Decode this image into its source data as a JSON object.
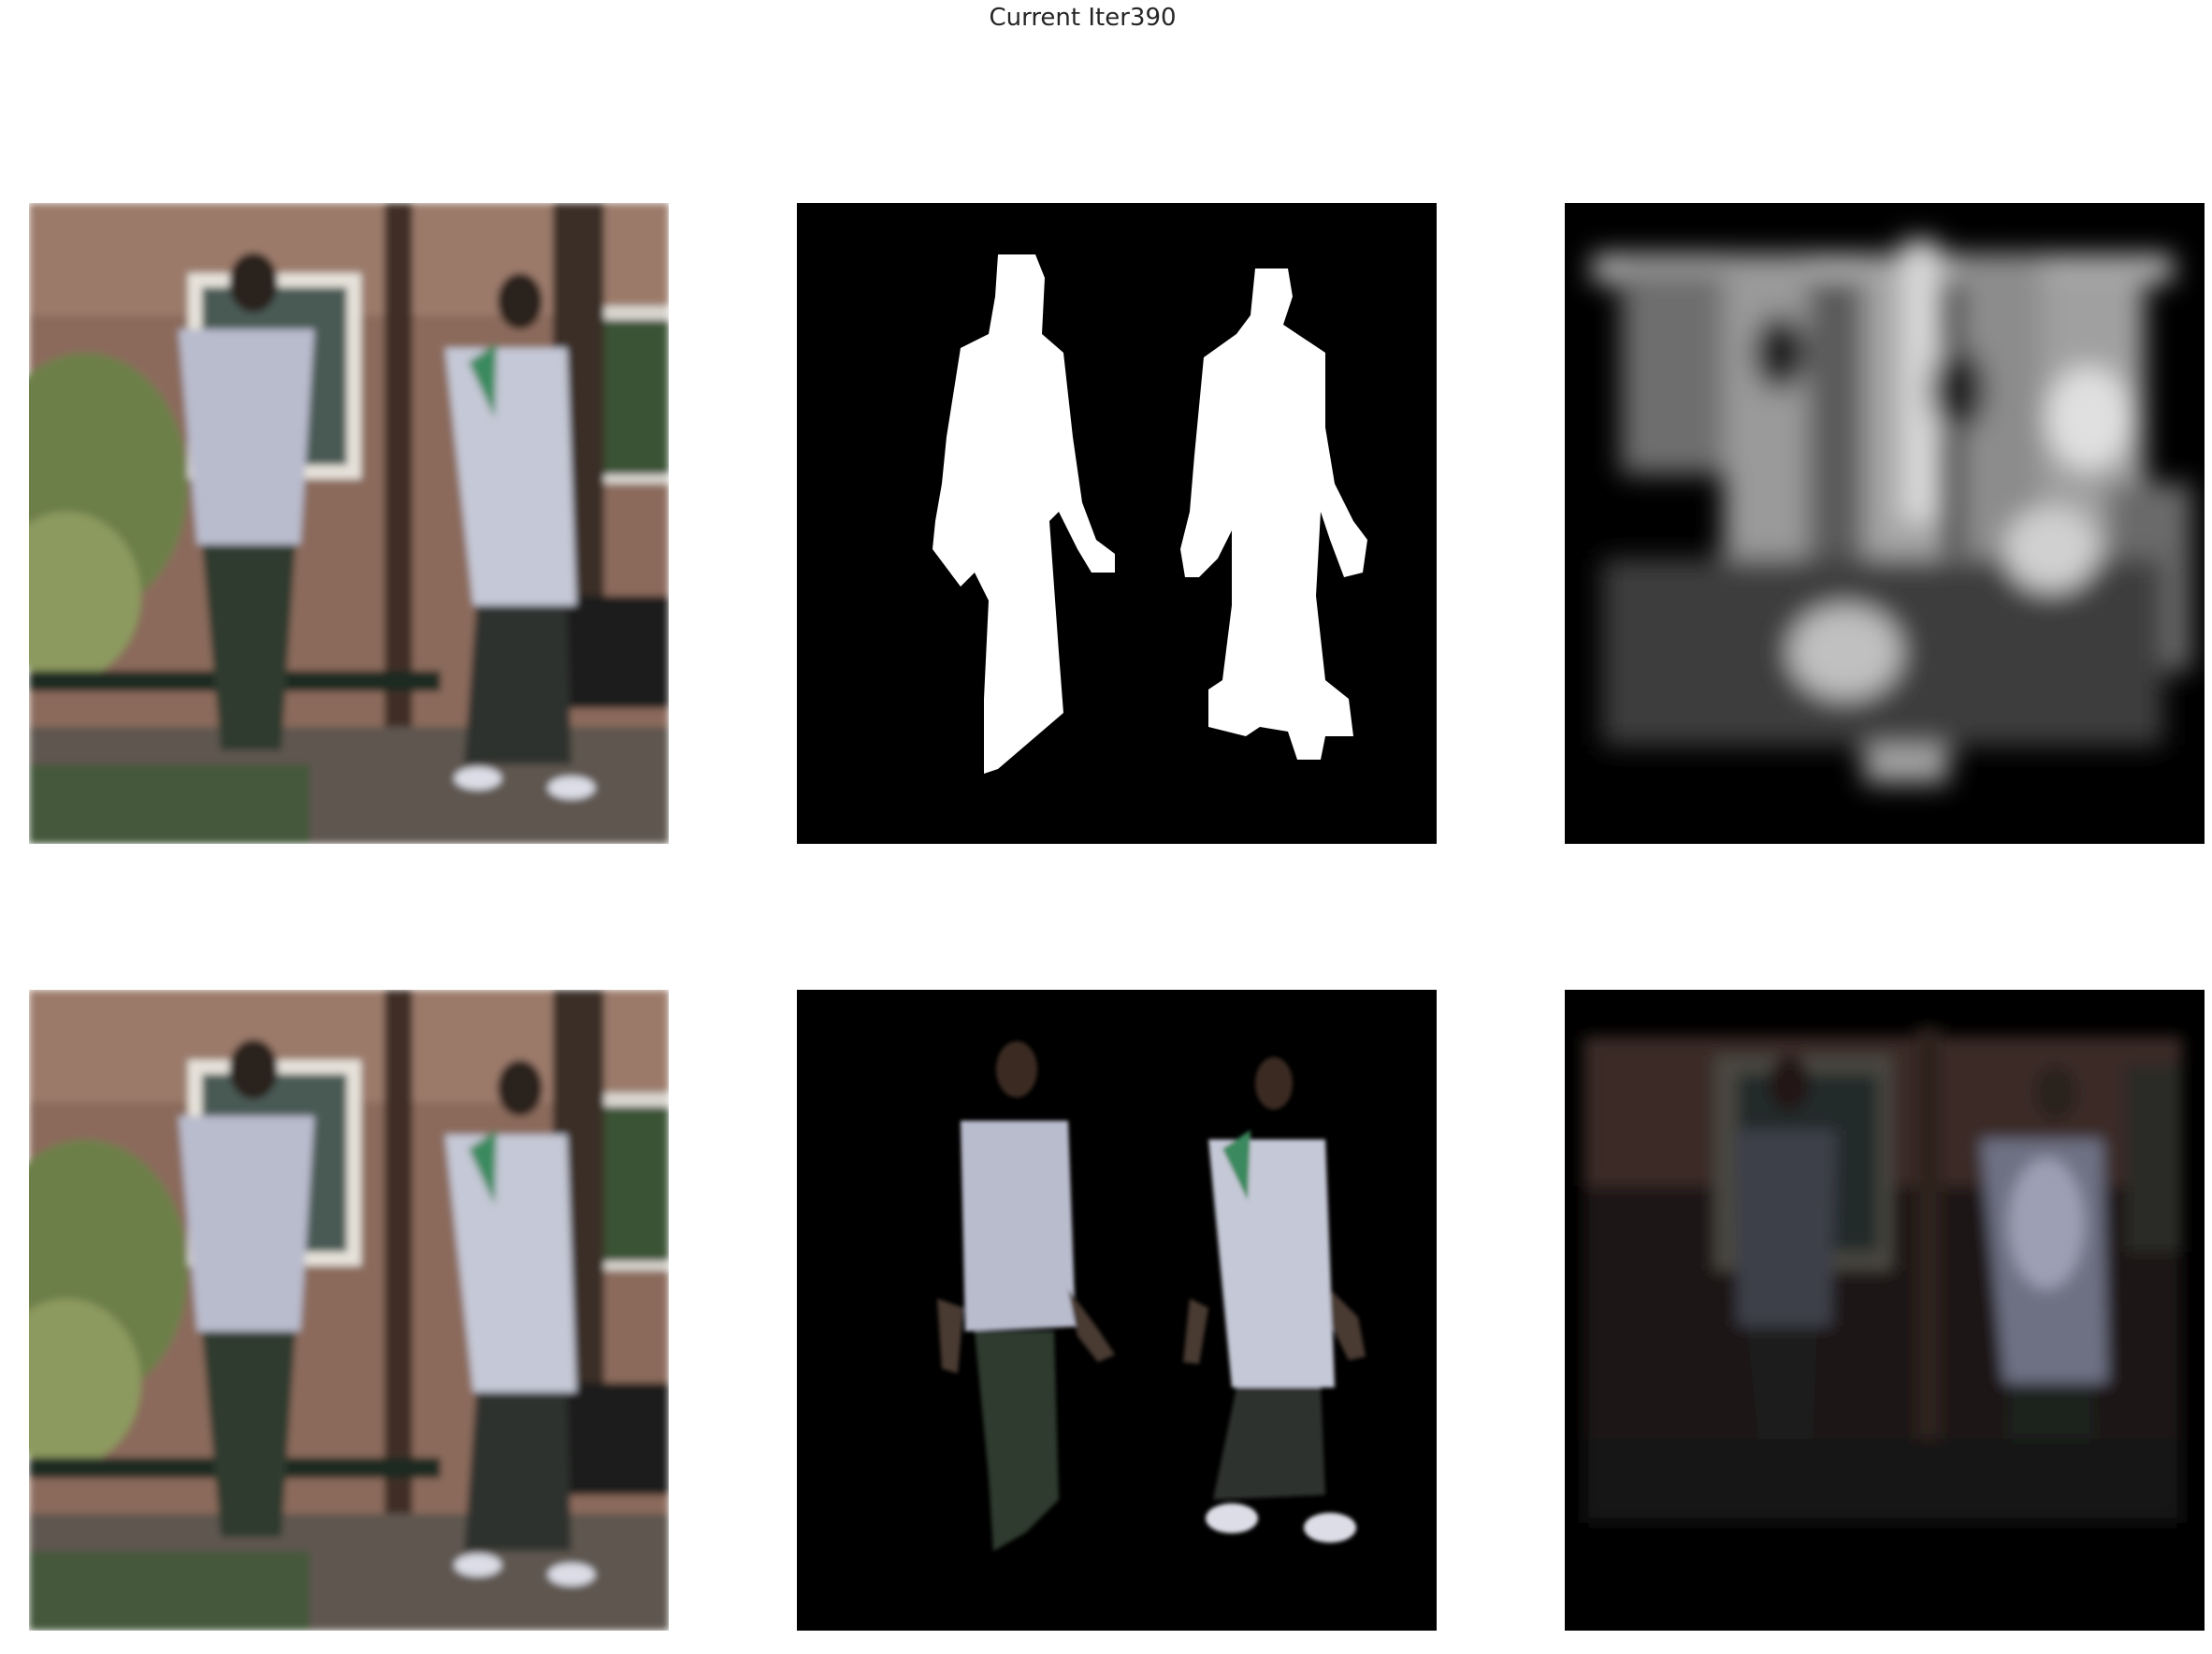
{
  "figure": {
    "title": "Current Iter390"
  },
  "panels": [
    {
      "key": "input-image",
      "row": 1,
      "col": 1
    },
    {
      "key": "ground-truth-mask",
      "row": 1,
      "col": 2
    },
    {
      "key": "predicted-mask",
      "row": 1,
      "col": 3
    },
    {
      "key": "input-image",
      "row": 2,
      "col": 1
    },
    {
      "key": "masked-foreground",
      "row": 2,
      "col": 2
    },
    {
      "key": "reconstruction",
      "row": 2,
      "col": 3
    }
  ],
  "colors": {
    "background": "#ffffff",
    "title_text": "#262626",
    "wall": "#8a6a5a",
    "shirt": "#b9bccd",
    "pants": "#2f3a2e",
    "foliage": "#4f6b3a",
    "mask_fg": "#ffffff",
    "mask_bg": "#000000"
  }
}
